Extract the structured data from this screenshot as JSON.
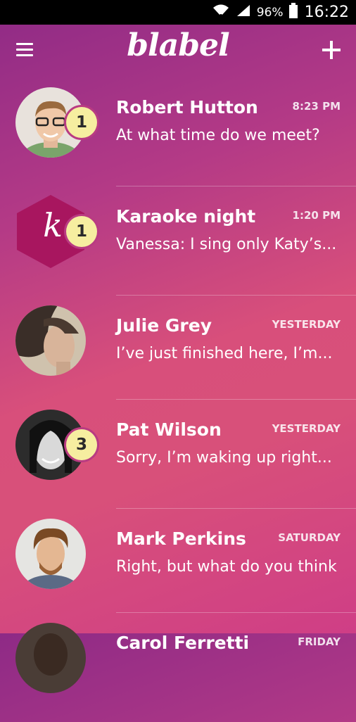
{
  "status": {
    "battery": "96%",
    "clock": "16:22"
  },
  "header": {
    "logo": "blabel"
  },
  "conversations": [
    {
      "name": "Robert Hutton",
      "time": "8:23 PM",
      "message": "At what time do we meet?",
      "badge": "1"
    },
    {
      "name": "Karaoke night",
      "time": "1:20 PM",
      "message": "Vanessa: I sing only Katy’s...",
      "badge": "1",
      "group_letter": "k"
    },
    {
      "name": "Julie Grey",
      "time": "YESTERDAY",
      "message": "I’ve just finished here, I’m...",
      "badge": ""
    },
    {
      "name": "Pat Wilson",
      "time": "YESTERDAY",
      "message": "Sorry, I’m waking up right...",
      "badge": "3"
    },
    {
      "name": "Mark Perkins",
      "time": "SATURDAY",
      "message": "Right, but what do you think",
      "badge": ""
    },
    {
      "name": "Carol Ferretti",
      "time": "FRIDAY",
      "message": "",
      "badge": ""
    }
  ]
}
